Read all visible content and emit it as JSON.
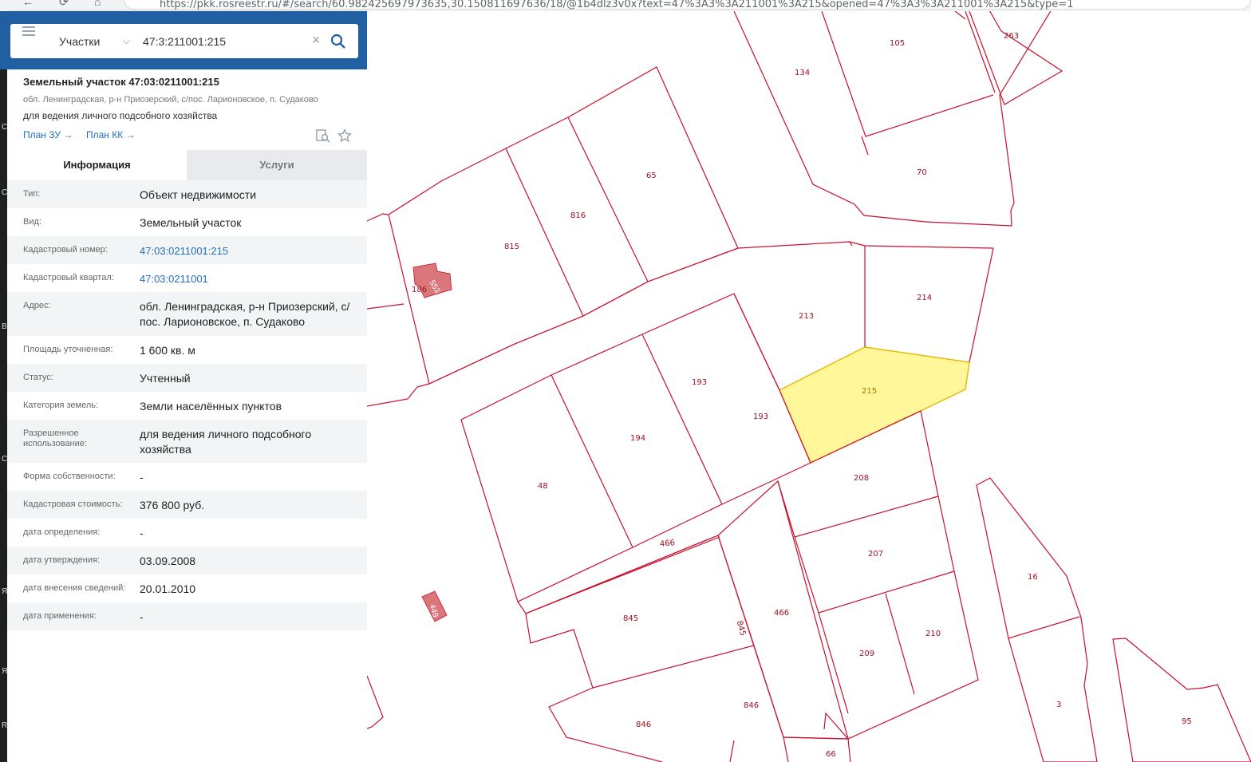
{
  "browser": {
    "url": "https://pkk.rosreestr.ru/#/search/60.982425697973635,30.150811697636/18/@1b4dlz3v0x?text=47%3A3%3A211001%3A215&opened=47%3A3%3A211001%3A215&type=1"
  },
  "search": {
    "type_label": "Участки",
    "query": "47:3:211001:215"
  },
  "object": {
    "title": "Земельный участок 47:03:0211001:215",
    "address_short": "обл. Ленинградская, р-н Приозерский, с/пос. Ларионовское, п. Судаково",
    "usage": "для ведения личного подсобного хозяйства",
    "plan_zu": "План ЗУ →",
    "plan_kk": "План КК →"
  },
  "tabs": {
    "info": "Информация",
    "services": "Услуги"
  },
  "info_rows": [
    {
      "label": "Тип:",
      "value": "Объект недвижимости"
    },
    {
      "label": "Вид:",
      "value": "Земельный участок"
    },
    {
      "label": "Кадастровый номер:",
      "value": "47:03:0211001:215"
    },
    {
      "label": "Кадастровый квартал:",
      "value": "47:03:0211001"
    },
    {
      "label": "Адрес:",
      "value": "обл. Ленинградская, р-н Приозерский, с/пос. Ларионовское, п. Судаково"
    },
    {
      "label": "Площадь уточненная:",
      "value": "1 600 кв. м"
    },
    {
      "label": "Статус:",
      "value": "Учтенный"
    },
    {
      "label": "Категория земель:",
      "value": "Земли населённых пунктов"
    },
    {
      "label": "Разрешенное использование:",
      "value": "для ведения личного подсобного хозяйства"
    },
    {
      "label": "Форма собственности:",
      "value": "-"
    },
    {
      "label": "Кадастровая стоимость:",
      "value": "376 800 руб."
    },
    {
      "label": "дата определения:",
      "value": "-"
    },
    {
      "label": "дата утверждения:",
      "value": "03.09.2008"
    },
    {
      "label": "дата внесения сведений:",
      "value": "20.01.2010"
    },
    {
      "label": "дата применения:",
      "value": "-"
    }
  ],
  "map": {
    "parcel_labels": [
      "263",
      "105",
      "134",
      "70",
      "65",
      "816",
      "815",
      "186",
      "553",
      "214",
      "213",
      "215",
      "193",
      "193",
      "194",
      "48",
      "208",
      "207",
      "466",
      "466",
      "845",
      "845",
      "210",
      "209",
      "16",
      "3",
      "846",
      "846",
      "95",
      "66",
      "449"
    ],
    "colors": {
      "parcel_stroke": "#c8102e",
      "selected_fill": "#fff799",
      "building": "#d9777a",
      "panel_header": "#1f5fa2"
    }
  }
}
